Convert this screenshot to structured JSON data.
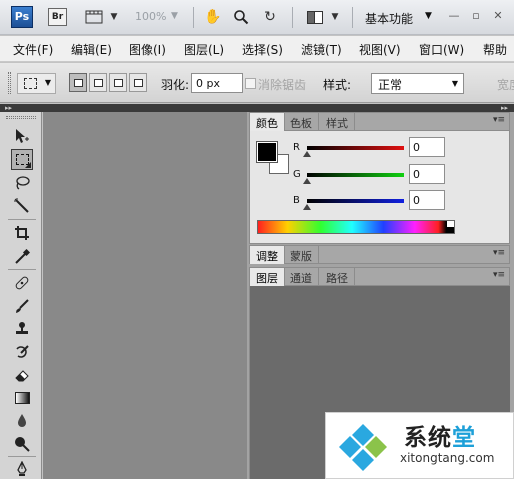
{
  "appbar": {
    "app_logo": "Ps",
    "bridge_logo": "Br",
    "zoom": "100%",
    "workspace": "基本功能"
  },
  "menubar": {
    "items": [
      "文件(F)",
      "编辑(E)",
      "图像(I)",
      "图层(L)",
      "选择(S)",
      "滤镜(T)",
      "视图(V)",
      "窗口(W)",
      "帮助"
    ]
  },
  "options": {
    "feather_label": "羽化:",
    "feather_value": "0 px",
    "antialias_label": "消除锯齿",
    "style_label": "样式:",
    "style_value": "正常",
    "width_label": "宽度:"
  },
  "color_panel": {
    "tabs": [
      "颜色",
      "色板",
      "样式"
    ],
    "active_tab": "颜色",
    "channels": [
      {
        "label": "R",
        "value": "0",
        "gradient_end": "#e01010"
      },
      {
        "label": "G",
        "value": "0",
        "gradient_end": "#10d010"
      },
      {
        "label": "B",
        "value": "0",
        "gradient_end": "#1020e0"
      }
    ],
    "foreground": "#000000",
    "background": "#ffffff"
  },
  "adjust_panel": {
    "tabs": [
      "调整",
      "蒙版"
    ]
  },
  "layers_panel": {
    "tabs": [
      "图层",
      "通道",
      "路径"
    ]
  },
  "tools": [
    "move-tool",
    "marquee-tool",
    "lasso-tool",
    "magic-wand-tool",
    "crop-tool",
    "eyedropper-tool",
    "healing-brush-tool",
    "brush-tool",
    "clone-stamp-tool",
    "history-brush-tool",
    "eraser-tool",
    "gradient-tool",
    "blur-tool",
    "dodge-tool",
    "pen-tool"
  ],
  "watermark": {
    "title_a": "系统",
    "title_b": "堂",
    "url": "xitongtang.com"
  }
}
